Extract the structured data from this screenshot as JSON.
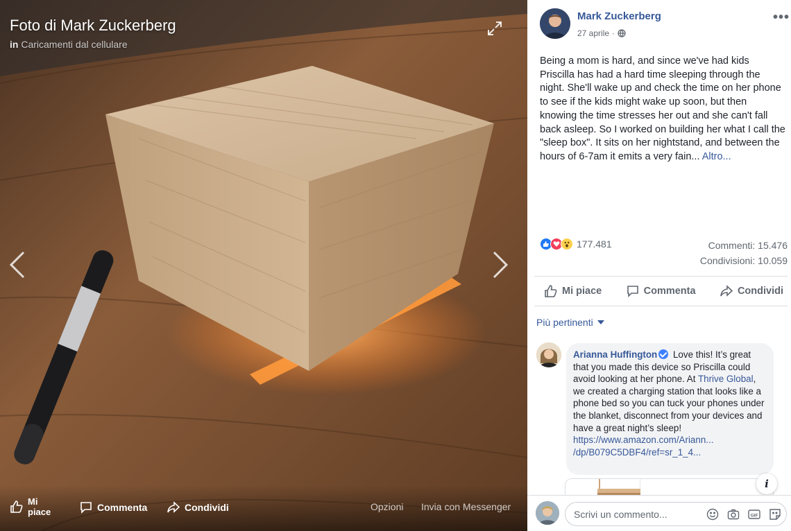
{
  "viewer": {
    "title": "Foto di Mark Zuckerberg",
    "subtitle_prefix": "in",
    "subtitle_album": "Caricamenti dal cellulare",
    "bar": {
      "like": "Mi piace",
      "comment": "Commenta",
      "share": "Condividi",
      "options": "Opzioni",
      "messenger": "Invia con Messenger"
    }
  },
  "post": {
    "author": "Mark Zuckerberg",
    "date": "27 aprile",
    "privacy_separator": "·",
    "more_menu": "•••",
    "text": "Being a mom is hard, and since we've had kids Priscilla has had a hard time sleeping through the night. She'll wake up and check the time on her phone to see if the kids might wake up soon, but then knowing the time stresses her out and she can't fall back asleep. So I worked on building her what I call the \"sleep box\". It sits on her nightstand, and between the hours of 6-7am it emits a very fain...",
    "see_more": "Altro...",
    "reactions_count": "177.481",
    "comments_count": "Commenti: 15.476",
    "shares_count": "Condivisioni: 10.059",
    "actions": {
      "like": "Mi piace",
      "comment": "Commenta",
      "share": "Condividi"
    }
  },
  "comments": {
    "filter": "Più pertinenti",
    "items": [
      {
        "author": "Arianna Huffington",
        "text_part1": "Love this! It’s great that you made this device so Priscilla could avoid looking at her phone. At",
        "mention": "Thrive Global",
        "text_part2": ", we created a charging station that looks like a phone bed so you can tuck your phones under the blanket, disconnect from your devices and have a great night’s sleep!",
        "link_line1": "https://www.amazon.com/Ariann...",
        "link_line2": "/dp/B079C5DBF4/ref=sr_1_4..."
      }
    ],
    "info_button": "i",
    "composer_placeholder": "Scrivi un commento..."
  },
  "colors": {
    "link_blue": "#365899",
    "like_blue": "#2078f4",
    "love_red": "#f33e58",
    "wow_yellow": "#fcd14d"
  },
  "icons": [
    "expand-icon",
    "chevron-left-icon",
    "chevron-right-icon",
    "like-icon",
    "comment-icon",
    "share-icon",
    "globe-icon",
    "caret-down-icon",
    "emoji-icon",
    "camera-icon",
    "gif-icon",
    "sticker-icon"
  ]
}
